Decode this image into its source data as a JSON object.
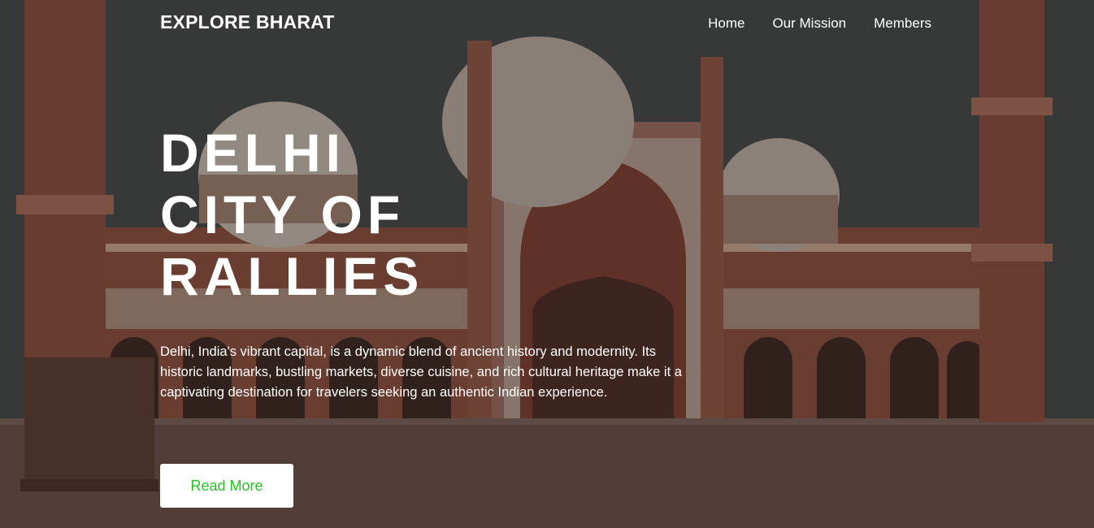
{
  "nav": {
    "brand": "EXPLORE BHARAT",
    "links": [
      {
        "label": "Home"
      },
      {
        "label": "Our Mission"
      },
      {
        "label": "Members"
      }
    ]
  },
  "hero": {
    "title_line1": "DELHI",
    "title_line2": "CITY OF",
    "title_line3": "RALLIES",
    "description": "Delhi, India's vibrant capital, is a dynamic blend of ancient history and modernity. Its historic landmarks, bustling markets, diverse cuisine, and rich cultural heritage make it a captivating destination for travelers seeking an authentic Indian experience.",
    "cta_label": "Read More"
  },
  "colors": {
    "accent": "#1ec71e",
    "text": "#ffffff",
    "button_bg": "#ffffff"
  }
}
